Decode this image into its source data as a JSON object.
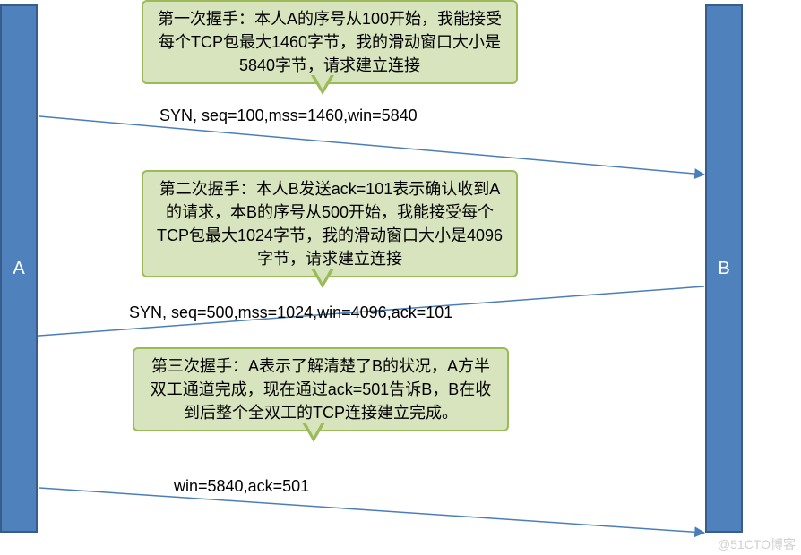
{
  "endpoints": {
    "a_label": "A",
    "b_label": "B"
  },
  "handshakes": [
    {
      "callout": "第一次握手：本人A的序号从100开始，我能接受每个TCP包最大1460字节，我的滑动窗口大小是5840字节，请求建立连接",
      "packet": "SYN, seq=100,mss=1460,win=5840"
    },
    {
      "callout": "第二次握手：本人B发送ack=101表示确认收到A的请求，本B的序号从500开始，我能接受每个TCP包最大1024字节，我的滑动窗口大小是4096字节，请求建立连接",
      "packet": "SYN, seq=500,mss=1024,win=4096,ack=101"
    },
    {
      "callout": "第三次握手：A表示了解清楚了B的状况，A方半双工通道完成，现在通过ack=501告诉B，B在收到后整个全双工的TCP连接建立完成。",
      "packet": "win=5840,ack=501"
    }
  ],
  "watermark": "@51CTO博客"
}
